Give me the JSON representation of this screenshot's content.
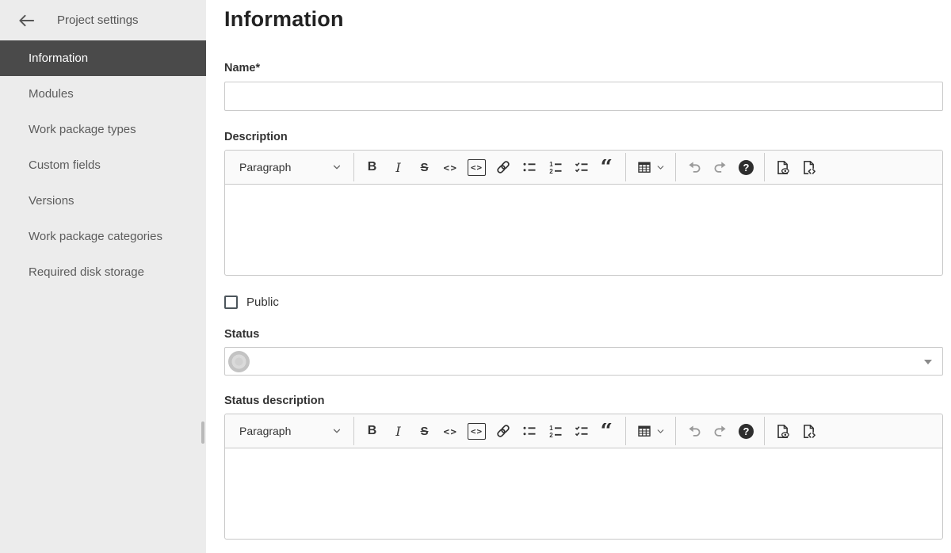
{
  "sidebar": {
    "title": "Project settings",
    "items": [
      {
        "label": "Information",
        "active": true
      },
      {
        "label": "Modules",
        "active": false
      },
      {
        "label": "Work package types",
        "active": false
      },
      {
        "label": "Custom fields",
        "active": false
      },
      {
        "label": "Versions",
        "active": false
      },
      {
        "label": "Work package categories",
        "active": false
      },
      {
        "label": "Required disk storage",
        "active": false
      }
    ]
  },
  "main": {
    "title": "Information",
    "fields": {
      "name": {
        "label": "Name*",
        "value": "",
        "required": true
      },
      "description": {
        "label": "Description",
        "value": ""
      },
      "public": {
        "label": "Public",
        "checked": false
      },
      "status": {
        "label": "Status",
        "value": ""
      },
      "status_description": {
        "label": "Status description",
        "value": ""
      }
    }
  },
  "editor_toolbar": {
    "paragraph_label": "Paragraph",
    "icons": {
      "bold": "B",
      "italic": "I",
      "strikethrough": "S",
      "code": "<>",
      "quote": "“",
      "help": "?",
      "ol1": "1",
      "ol2": "2"
    },
    "buttons": [
      "paragraph-style",
      "bold",
      "italic",
      "strikethrough",
      "inline-code",
      "code-block",
      "link",
      "bulleted-list",
      "numbered-list",
      "todo-list",
      "block-quote",
      "insert-table",
      "undo",
      "redo",
      "help",
      "preview",
      "markdown-source"
    ]
  },
  "colors": {
    "sidebar_bg": "#ececec",
    "sidebar_active_bg": "#4a4a4a",
    "sidebar_active_text": "#ffffff",
    "border": "#c8c8c8",
    "toolbar_bg": "#fafafa",
    "text": "#333333",
    "muted_text": "#5c5c5c",
    "disabled_icon": "#9a9a9a"
  }
}
